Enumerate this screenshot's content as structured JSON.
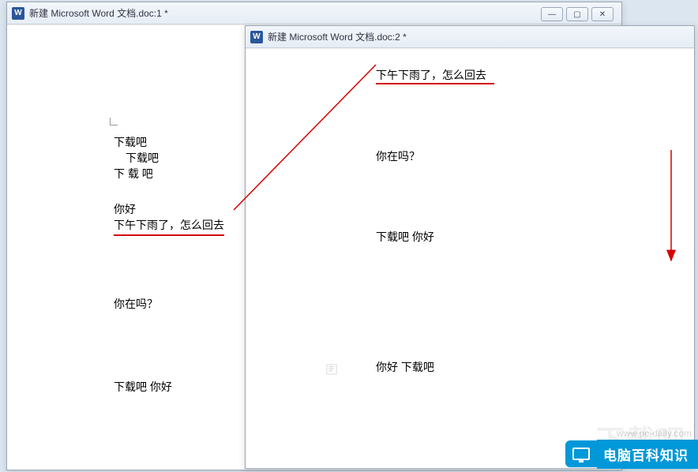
{
  "windowControls": {
    "minimize": "—",
    "maximize": "▢",
    "close": "✕"
  },
  "window1": {
    "title": "新建 Microsoft Word 文档.doc:1 *",
    "lines": {
      "l1": "下载吧",
      "l2": "下载吧",
      "l3": "下 载   吧",
      "l4": "你好",
      "l5": "下午下雨了，怎么回去",
      "l6": "你在吗？",
      "l7": "下载吧 你好"
    }
  },
  "window2": {
    "title": "新建 Microsoft Word 文档.doc:2 *",
    "lines": {
      "t1": "下午下雨了，怎么回去",
      "t2": "你在吗？",
      "t3": "下载吧 你好",
      "t4": "你好   下载吧"
    }
  },
  "watermark": "下载吧",
  "badge": {
    "text": "电脑百科知识",
    "url": "www.pc-daily.com"
  }
}
